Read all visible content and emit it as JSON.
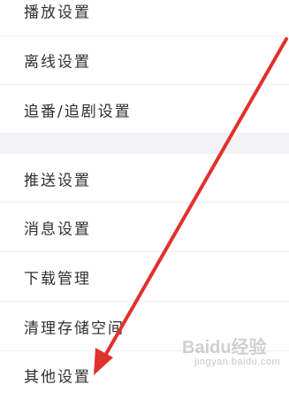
{
  "settings_list": {
    "items": [
      {
        "label": "播放设置"
      },
      {
        "label": "离线设置"
      },
      {
        "label": "追番/追剧设置"
      },
      {
        "label": "推送设置"
      },
      {
        "label": "消息设置"
      },
      {
        "label": "下载管理"
      },
      {
        "label": "清理存储空间"
      },
      {
        "label": "其他设置"
      }
    ]
  },
  "annotation": {
    "arrow_color": "#e0322b"
  },
  "watermark": {
    "logo_text": "Baidu经验",
    "sub_text": "jingyan.baidu.com"
  }
}
